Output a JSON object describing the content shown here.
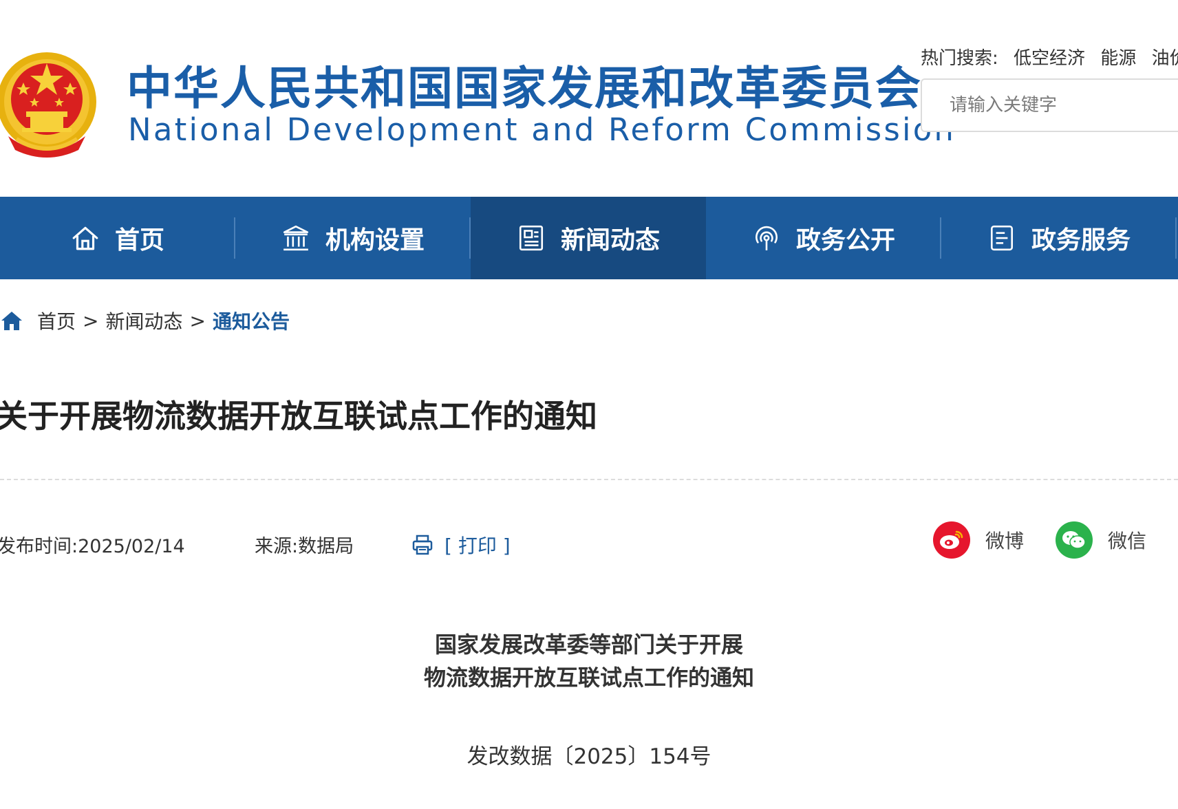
{
  "header": {
    "title_cn": "中华人民共和国国家发展和改革委员会",
    "title_en": "National Development and Reform Commission",
    "emblem_icon": "national-emblem-icon",
    "hot_search": {
      "label": "热门搜索:",
      "keywords": [
        "低空经济",
        "能源",
        "油价"
      ]
    },
    "search": {
      "placeholder": "请输入关键字"
    }
  },
  "nav": {
    "items": [
      {
        "label": "首页",
        "icon": "home-icon"
      },
      {
        "label": "机构设置",
        "icon": "institution-icon"
      },
      {
        "label": "新闻动态",
        "icon": "news-icon",
        "active": true
      },
      {
        "label": "政务公开",
        "icon": "broadcast-icon"
      },
      {
        "label": "政务服务",
        "icon": "document-icon"
      }
    ],
    "colors": {
      "bg": "#1c5b9c",
      "active_bg": "#174a80"
    }
  },
  "breadcrumb": {
    "items": [
      "首页",
      "新闻动态",
      "通知公告"
    ],
    "separator": ">"
  },
  "article": {
    "title": "关于开展物流数据开放互联试点工作的通知",
    "publish_label": "发布时间:",
    "publish_date": "2025/02/14",
    "source_label": "来源:",
    "source": "数据局",
    "print_label": "[ 打印 ]",
    "share": [
      {
        "label": "微博",
        "icon": "weibo-icon",
        "color": "#e6162d"
      },
      {
        "label": "微信",
        "icon": "wechat-icon",
        "color": "#2bb24c"
      }
    ],
    "doc_heading_lines": [
      "国家发展改革委等部门关于开展",
      "物流数据开放互联试点工作的通知"
    ],
    "doc_number": "发改数据〔2025〕154号"
  }
}
